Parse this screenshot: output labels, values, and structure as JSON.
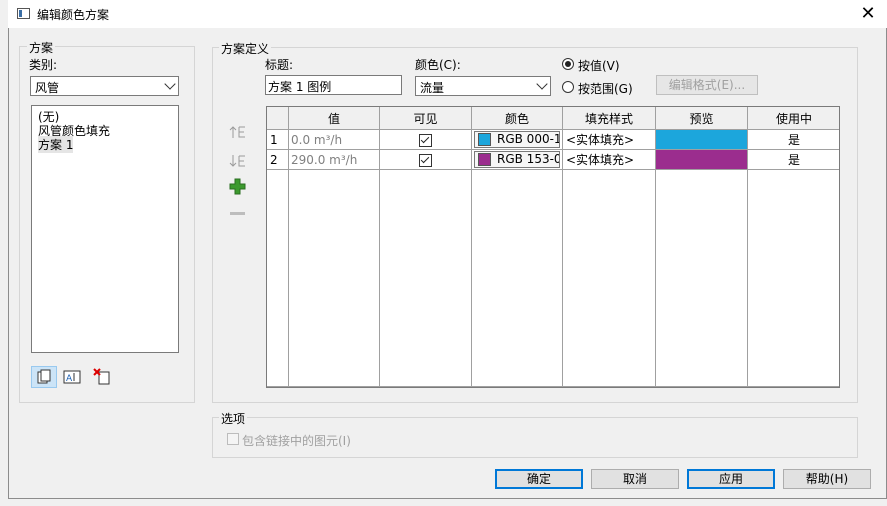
{
  "window": {
    "title": "编辑颜色方案",
    "close_glyph": "✕"
  },
  "scheme": {
    "group_label": "方案",
    "category_label": "类别:",
    "category_value": "风管",
    "list_items": [
      "(无)",
      "风管颜色填充",
      "方案 1"
    ]
  },
  "definition": {
    "group_label": "方案定义",
    "title_label": "标题:",
    "title_value": "方案 1 图例",
    "color_label": "颜色(C):",
    "color_value": "流量",
    "by_value_label": "按值(V)",
    "by_range_label": "按范围(G)",
    "edit_format_label": "编辑格式(E)...",
    "selected_mode": "by_value"
  },
  "table": {
    "headers": [
      "值",
      "可见",
      "颜色",
      "填充样式",
      "预览",
      "使用中"
    ],
    "rows": [
      {
        "num": "1",
        "value": "0.0 m³/h",
        "visible": true,
        "color_label": "RGB 000-1",
        "swatch": "#1ca6dc",
        "fill": "<实体填充>",
        "in_use": "是"
      },
      {
        "num": "2",
        "value": "290.0 m³/h",
        "visible": true,
        "color_label": "RGB 153-0",
        "swatch": "#9b2d8e",
        "fill": "<实体填充>",
        "in_use": "是"
      }
    ]
  },
  "options": {
    "group_label": "选项",
    "include_links_label": "包含链接中的图元(I)"
  },
  "buttons": {
    "ok": "确定",
    "cancel": "取消",
    "apply": "应用",
    "help": "帮助(H)"
  },
  "icons": {
    "move_up": "move-up-icon",
    "move_down": "move-down-icon",
    "add": "add-icon",
    "remove": "remove-icon",
    "duplicate": "duplicate-icon",
    "rename": "rename-icon",
    "delete": "delete-icon"
  },
  "colors": {
    "accent": "#0078d7",
    "add_green": "#3c9a2e"
  }
}
